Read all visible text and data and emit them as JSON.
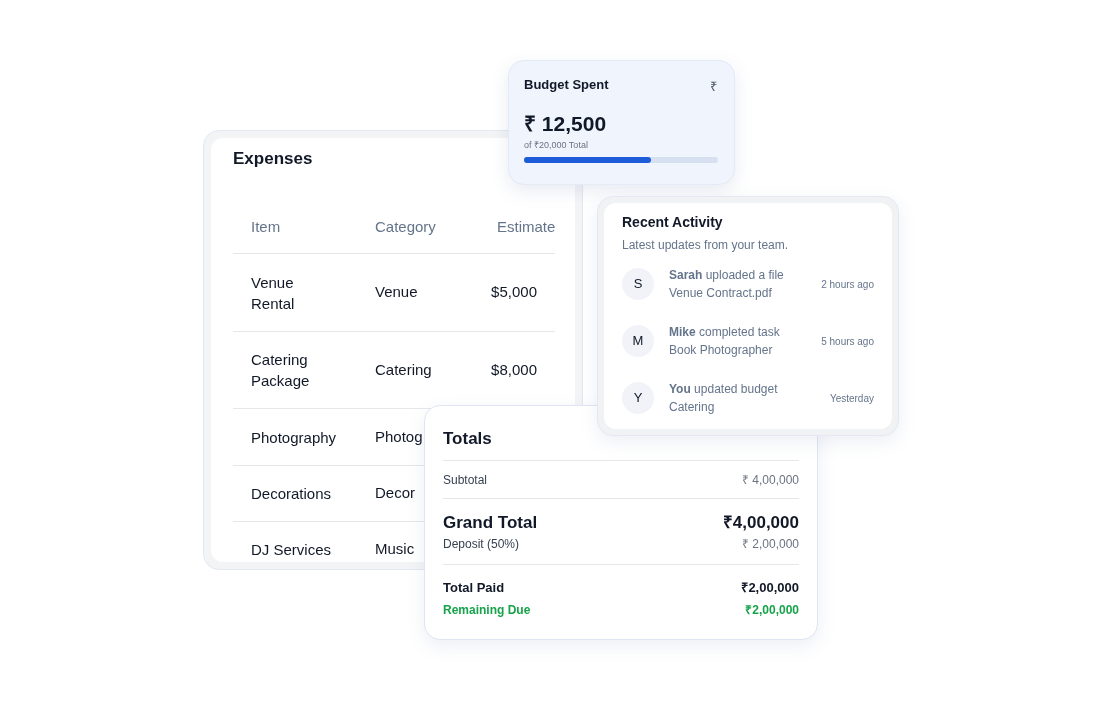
{
  "expenses": {
    "title": "Expenses",
    "columns": [
      "Item",
      "Category",
      "Estimate"
    ],
    "rows": [
      {
        "item": "Venue Rental",
        "category": "Venue",
        "estimate": "$5,000"
      },
      {
        "item": "Catering Package",
        "category": "Catering",
        "estimate": "$8,000"
      },
      {
        "item": "Photography",
        "category": "Photog"
      },
      {
        "item": "Decorations",
        "category": "Decor"
      },
      {
        "item": "DJ Services",
        "category": "Music"
      }
    ]
  },
  "budget": {
    "title": "Budget Spent",
    "icon_glyph": "₹",
    "amount": "₹ 12,500",
    "caption": "of ₹20,000 Total",
    "level": 0.655
  },
  "activity": {
    "title": "Recent Activity",
    "subtitle": "Latest updates from your team.",
    "items": [
      {
        "initial": "S",
        "text": "**Sarah** uploaded a file",
        "detail": "Venue Contract.pdf",
        "time": "2 hours ago"
      },
      {
        "initial": "M",
        "text": "**Mike** completed task",
        "detail": "Book Photographer",
        "time": "5 hours ago"
      },
      {
        "initial": "Y",
        "text": "**You** updated budget",
        "detail": "Catering",
        "time": "Yesterday"
      }
    ]
  },
  "totals": {
    "title": "Totals",
    "rows": [
      {
        "kind": "muted",
        "label": "Subtotal",
        "value": "₹ 4,00,000"
      },
      {
        "kind": "grand",
        "label": "Grand Total",
        "value": "₹4,00,000"
      },
      {
        "kind": "sub",
        "label": "Deposit (50%)",
        "value": "₹ 2,00,000"
      },
      {
        "kind": "paid",
        "label": "Total Paid",
        "value": "₹2,00,000"
      },
      {
        "kind": "due",
        "label": "Remaining Due",
        "value": "₹2,00,000"
      }
    ]
  }
}
